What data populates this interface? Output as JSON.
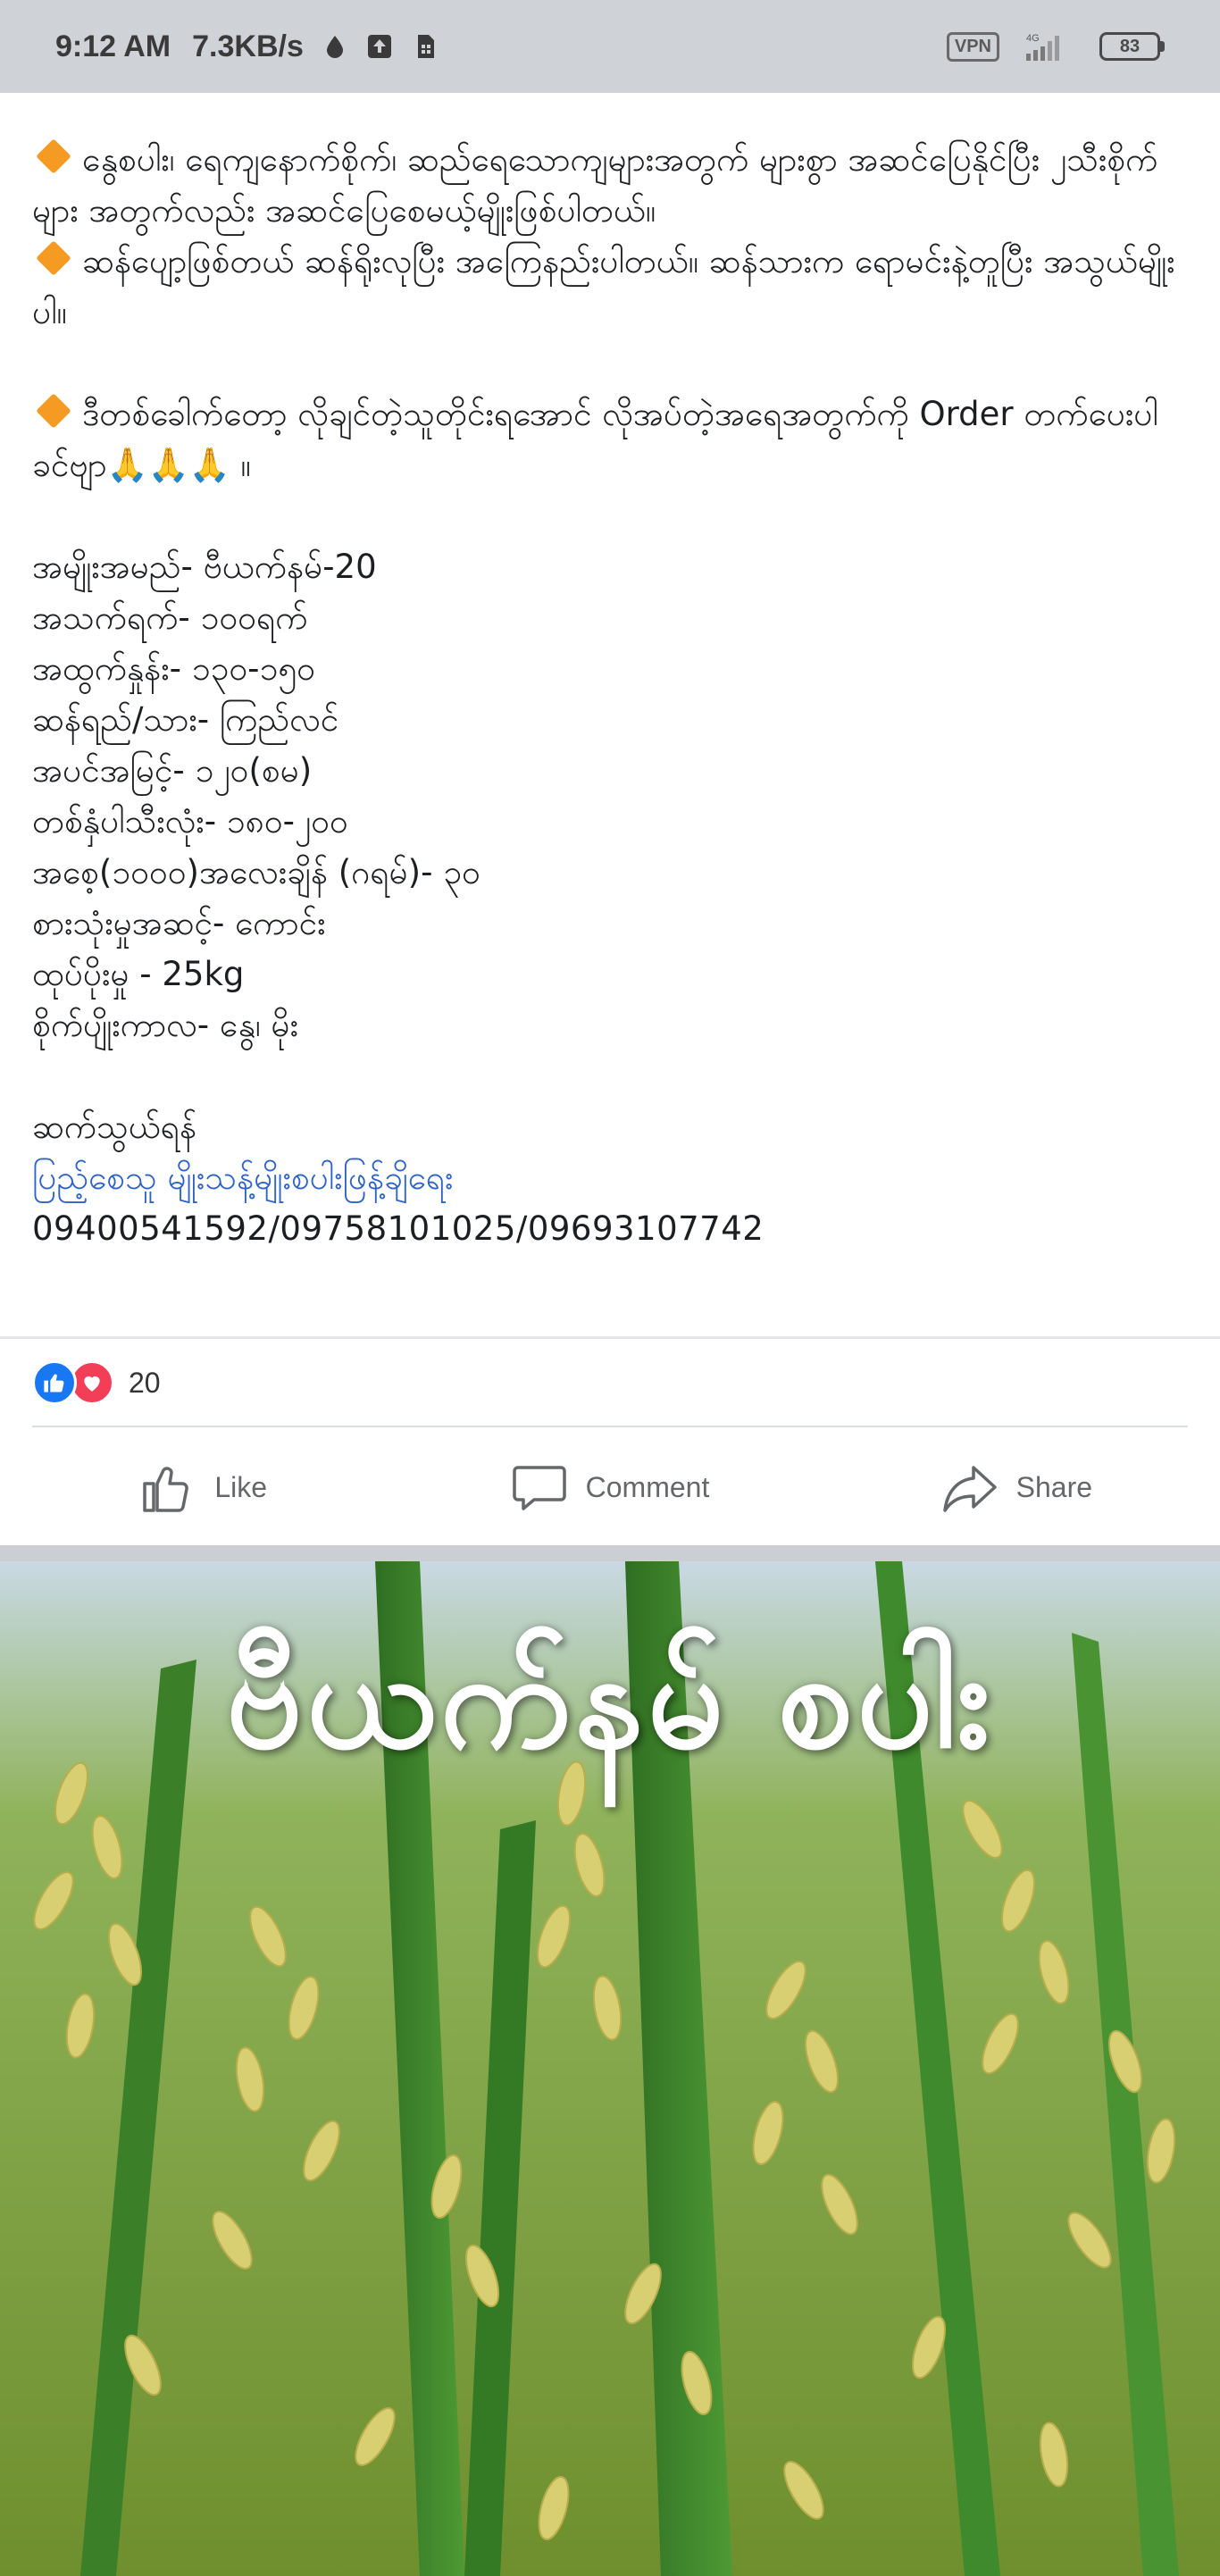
{
  "status_bar": {
    "time": "9:12 AM",
    "speed": "7.3KB/s",
    "vpn": "VPN",
    "network": "4G",
    "battery": "83"
  },
  "post": {
    "line1": "နွေစပါး၊ ရေကျနောက်စိုက်၊ ဆည်ရေသောကျများအတွက် များစွာ အဆင်ပြေနိုင်ပြီး ၂သီးစိုက်များ အတွက်လည်း အဆင်ပြေစေမယ့်မျိုးဖြစ်ပါတယ်။",
    "line2": "ဆန်ပျော့ဖြစ်တယ် ဆန်ရိုးလုပြီး အကြေနည်းပါတယ်။ ဆန်သားက ရောမင်းနဲ့တူပြီး အသွယ်မျိုးပါ။",
    "line3": "ဒီတစ်ခေါက်တော့ လိုချင်တဲ့သူတိုင်းရအောင် လိုအပ်တဲ့အရေအတွက်ကို Order တက်ပေးပါ",
    "line4": "ခင်ဗျာ🙏🙏🙏 ။",
    "specs": [
      "အမျိုးအမည်- ဗီယက်နမ်-20",
      "အသက်ရက်- ၁၀၀ရက်",
      "အထွက်နှုန်း- ၁၃၀-၁၅၀",
      "ဆန်ရည်/သား- ကြည်လင်",
      "အပင်အမြင့်- ၁၂၀(စမ)",
      "တစ်နှံပါသီးလုံး- ၁၈၀-၂၀၀",
      "အစေ့(၁၀၀၀)အလေးချိန် (ဂရမ်)- ၃၀",
      "စားသုံးမှုအဆင့်- ကောင်း",
      "ထုပ်ပိုးမှု - 25kg",
      "စိုက်ပျိုးကာလ- နွေ၊ မိုး"
    ],
    "contact_label": "ဆက်သွယ်ရန်",
    "contact_link": "ပြည့်စေသူ မျိုးသန့်မျိုးစပါးဖြန့်ချိရေး",
    "phones": "09400541592/09758101025/09693107742"
  },
  "reactions": {
    "count": "20"
  },
  "actions": {
    "like": "Like",
    "comment": "Comment",
    "share": "Share"
  },
  "photo": {
    "overlay_text": "ဗီယက်နမ် စပါး"
  }
}
